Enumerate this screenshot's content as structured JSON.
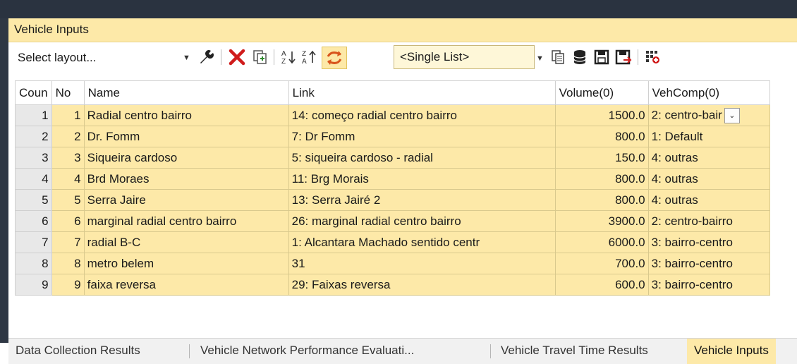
{
  "window": {
    "title": "Vehicle Inputs"
  },
  "toolbar": {
    "layout_select": "Select layout...",
    "list_select": "<Single List>",
    "icons": [
      "wrench-icon",
      "delete-icon",
      "duplicate-icon",
      "sort-ascending-icon",
      "sort-descending-icon",
      "synchronize-icon",
      "copy-icon",
      "database-icon",
      "save-icon",
      "save-as-icon",
      "add-columns-icon"
    ],
    "colors": {
      "delete": "#d01c1c",
      "sync": "#d8541c",
      "accent": "#fde9a8"
    }
  },
  "table": {
    "columns": [
      "Coun",
      "No",
      "Name",
      "Link",
      "Volume(0)",
      "VehComp(0)"
    ],
    "rows": [
      {
        "count": "1",
        "no": "1",
        "name": "Radial centro bairro",
        "link": "14: começo radial centro bairro",
        "volume": "1500.0",
        "vehcomp": "2: centro-bair"
      },
      {
        "count": "2",
        "no": "2",
        "name": "Dr. Fomm",
        "link": "7: Dr Fomm",
        "volume": "800.0",
        "vehcomp": "1: Default"
      },
      {
        "count": "3",
        "no": "3",
        "name": "Siqueira cardoso",
        "link": "5: siqueira cardoso - radial",
        "volume": "150.0",
        "vehcomp": "4: outras"
      },
      {
        "count": "4",
        "no": "4",
        "name": "Brd Moraes",
        "link": "11: Brg Morais",
        "volume": "800.0",
        "vehcomp": "4: outras"
      },
      {
        "count": "5",
        "no": "5",
        "name": "Serra Jaire",
        "link": "13: Serra Jairé 2",
        "volume": "800.0",
        "vehcomp": "4: outras"
      },
      {
        "count": "6",
        "no": "6",
        "name": "marginal radial centro bairro",
        "link": "26: marginal radial centro bairro",
        "volume": "3900.0",
        "vehcomp": "2: centro-bairro"
      },
      {
        "count": "7",
        "no": "7",
        "name": "radial B-C",
        "link": "1: Alcantara Machado sentido centr",
        "volume": "6000.0",
        "vehcomp": "3: bairro-centro"
      },
      {
        "count": "8",
        "no": "8",
        "name": "metro belem",
        "link": "31",
        "volume": "700.0",
        "vehcomp": "3: bairro-centro"
      },
      {
        "count": "9",
        "no": "9",
        "name": "faixa reversa",
        "link": "29: Faixas reversa",
        "volume": "600.0",
        "vehcomp": "3: bairro-centro"
      }
    ]
  },
  "tabs": [
    {
      "label": "Data Collection Results",
      "active": false
    },
    {
      "label": "Vehicle  Network  Performance  Evaluati...",
      "active": false
    },
    {
      "label": "Vehicle Travel Time Results",
      "active": false
    },
    {
      "label": "Vehicle Inputs",
      "active": true
    }
  ]
}
